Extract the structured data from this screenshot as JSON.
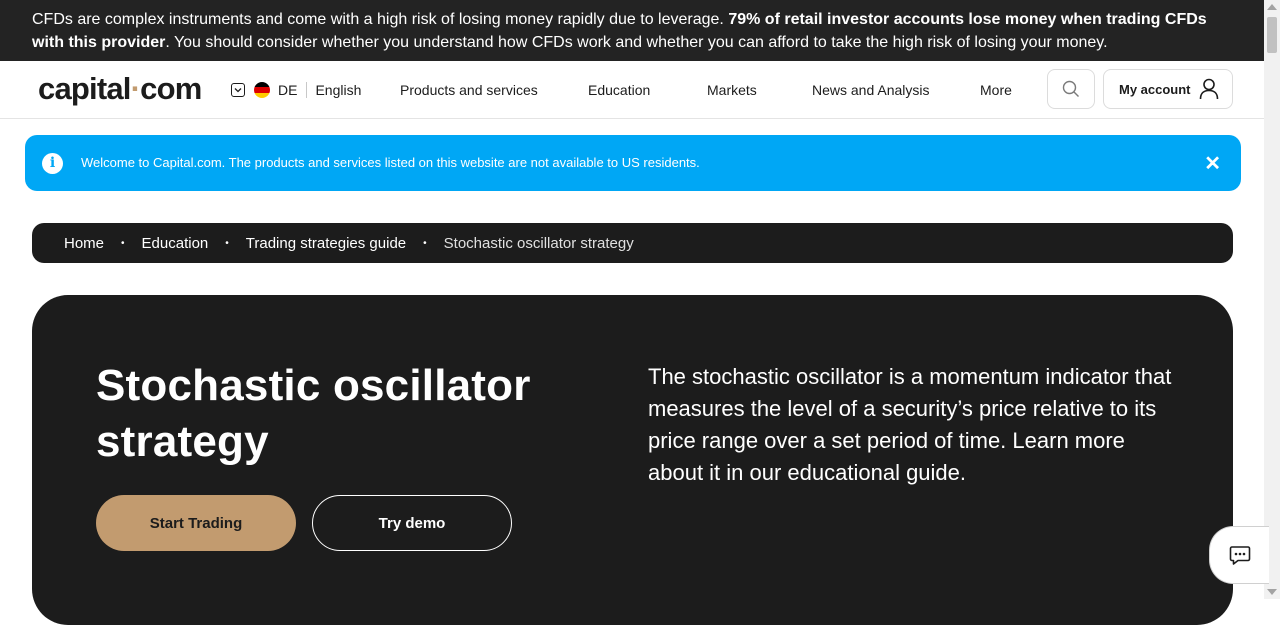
{
  "risk_warning": {
    "text_start": "CFDs are complex instruments and come with a high risk of losing money rapidly due to leverage. ",
    "text_bold": "79% of retail investor accounts lose money when trading CFDs with this provider",
    "text_end": ". You should consider whether you understand how CFDs work and whether you can afford to take the high risk of losing your money."
  },
  "header": {
    "logo": {
      "part1": "capital",
      "dot": "·",
      "part2": "com"
    },
    "country_code": "DE",
    "language": "English",
    "menu": [
      "Products and services",
      "Education",
      "Markets",
      "News and Analysis",
      "More"
    ],
    "account_label": "My account",
    "icons": {
      "search": "search-icon",
      "account": "user-icon",
      "chevron": "chevron-down-icon"
    }
  },
  "notice": {
    "text": "Welcome to Capital.com. The products and services listed on this website are not available to US residents.",
    "info_glyph": "i",
    "close_glyph": "✕"
  },
  "breadcrumb": {
    "items": [
      "Home",
      "Education",
      "Trading strategies guide"
    ],
    "current": "Stochastic oscillator strategy",
    "separator": "•"
  },
  "hero": {
    "title": "Stochastic oscillator strategy",
    "start_label": "Start Trading",
    "demo_label": "Try demo",
    "description": "The stochastic oscillator is a momentum indicator that measures the level of a security’s price relative to its price range over a set period of time. Learn more about it in our educational guide."
  },
  "colors": {
    "dark": "#1c1c1c",
    "accent": "#c29b6f",
    "notice_blue": "#00a7f5",
    "white": "#ffffff"
  }
}
